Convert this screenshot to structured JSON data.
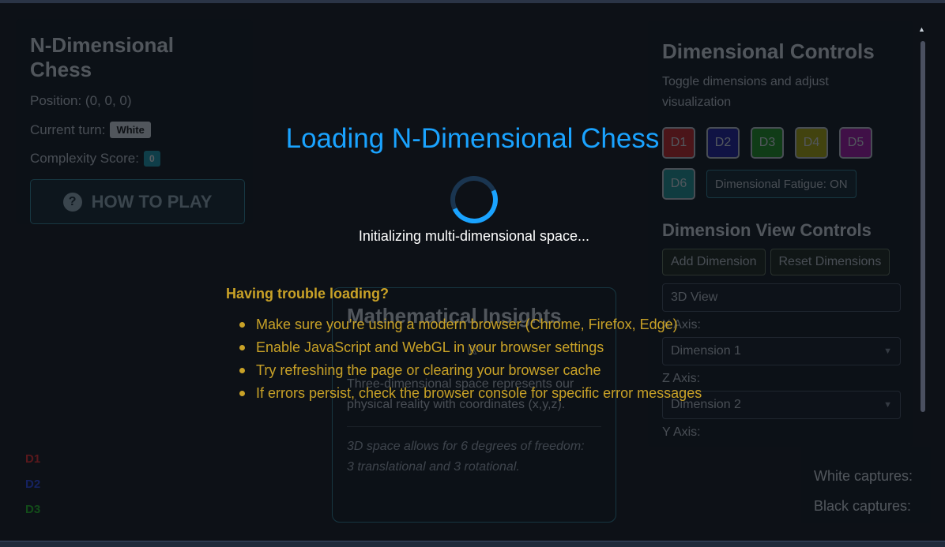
{
  "left_panel": {
    "title": "N-Dimensional Chess",
    "position": "Position: (0, 0, 0)",
    "turn_label": "Current turn:",
    "turn_value": "White",
    "complexity_label": "Complexity Score:",
    "complexity_value": "0",
    "how_to_play": "HOW TO PLAY",
    "how_to_play_icon": "question-circle-icon"
  },
  "axis_legend": [
    "D1",
    "D2",
    "D3"
  ],
  "insights": {
    "title": "Mathematical Insights",
    "icon_label": "ℝ³",
    "text": "Three-dimensional space represents our physical reality with coordinates (x,y,z).",
    "note_line1": "3D space allows for 6 degrees of freedom:",
    "note_line2": "3 translational and 3 rotational."
  },
  "controls": {
    "title": "Dimensional Controls",
    "subtitle": "Toggle dimensions and adjust visualization",
    "dimensions": [
      {
        "label": "D1",
        "color": "#d42020"
      },
      {
        "label": "D2",
        "color": "#1a1aa8"
      },
      {
        "label": "D3",
        "color": "#1a9a1a"
      },
      {
        "label": "D4",
        "color": "#b8b000"
      },
      {
        "label": "D5",
        "color": "#b010b0"
      },
      {
        "label": "D6",
        "color": "#1a9a9a"
      }
    ],
    "fatigue": "Dimensional Fatigue: ON",
    "view_title": "Dimension View Controls",
    "add_dimension": "Add Dimension",
    "reset_dimensions": "Reset Dimensions",
    "view_mode": "3D View",
    "x_axis_label": "X Axis:",
    "x_axis_value": "Dimension 1",
    "z_axis_label": "Z Axis:",
    "z_axis_value": "Dimension 2",
    "y_axis_label": "Y Axis:"
  },
  "captures": {
    "white": "White captures:",
    "black": "Black captures:"
  },
  "loading": {
    "title": "Loading N-Dimensional Chess",
    "message": "Initializing multi-dimensional space...",
    "trouble_title": "Having trouble loading?",
    "tips": [
      "Make sure you're using a modern browser (Chrome, Firefox, Edge)",
      "Enable JavaScript and WebGL in your browser settings",
      "Try refreshing the page or clearing your browser cache",
      "If errors persist, check the browser console for specific error messages"
    ],
    "accent": "#1aa3ff",
    "warning_color": "#c9a227"
  }
}
